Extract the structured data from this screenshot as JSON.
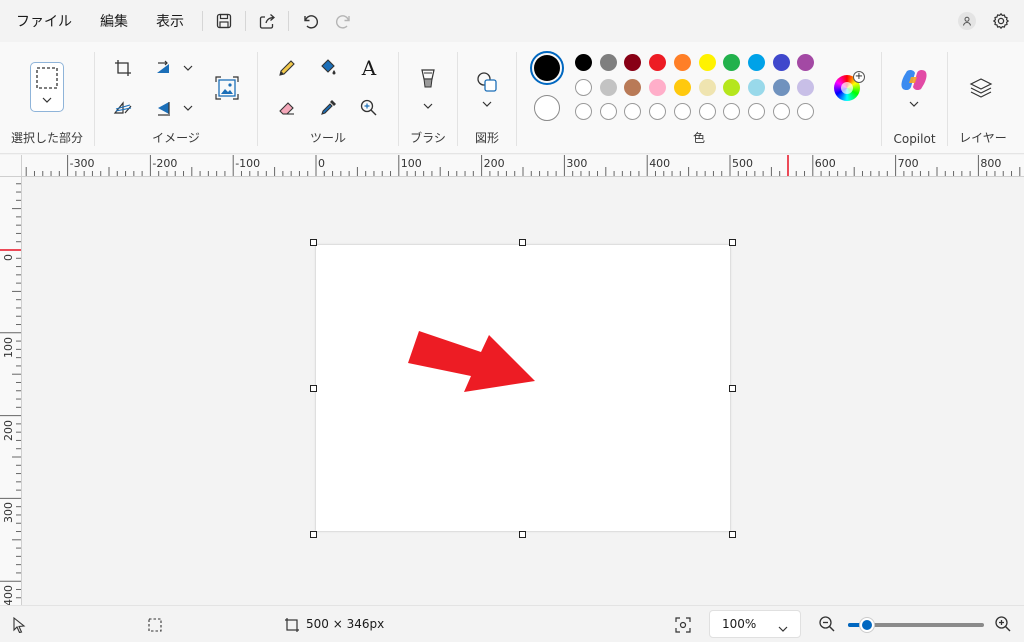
{
  "menubar": {
    "file": "ファイル",
    "edit": "編集",
    "view": "表示",
    "icons": [
      "save-icon",
      "share-icon",
      "undo-icon",
      "redo-icon"
    ]
  },
  "ribbon": {
    "groups": {
      "selection": "選択した部分",
      "image": "イメージ",
      "tools": "ツール",
      "brush": "ブラシ",
      "shapes": "図形",
      "colors": "色",
      "copilot": "Copilot",
      "layers": "レイヤー"
    },
    "text_tool_glyph": "A",
    "color1": "#000000",
    "color2": "#ffffff",
    "palette_row1": [
      "#000000",
      "#7f7f7f",
      "#880015",
      "#ed1c24",
      "#ff7f27",
      "#fff200",
      "#22b14c",
      "#00a2e8",
      "#3f48cc",
      "#a349a4"
    ],
    "palette_row2": [
      "#ffffff",
      "#c3c3c3",
      "#b97a57",
      "#ffaec9",
      "#ffc90e",
      "#efe4b0",
      "#b5e61d",
      "#99d9ea",
      "#7092be",
      "#c8bfe7"
    ],
    "palette_row3_count": 10
  },
  "rulers": {
    "horizontal": [
      "-300",
      "-200",
      "-100",
      "0",
      "100",
      "200",
      "300",
      "400",
      "500",
      "600",
      "700",
      "800"
    ],
    "vertical": [
      "0",
      "100",
      "200",
      "300",
      "400"
    ]
  },
  "canvas": {
    "arrow_color": "#ed1c24"
  },
  "status": {
    "canvas_size": "500 × 346px",
    "zoom": "100%",
    "zoom_slider_fraction": 0.14
  }
}
